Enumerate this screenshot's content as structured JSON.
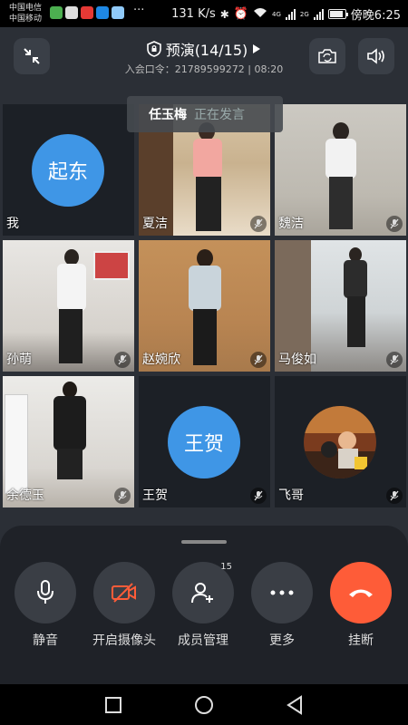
{
  "status_bar": {
    "carrier_1": "中国电信",
    "carrier_2": "中国移动",
    "more": "···",
    "speed": "131 K/s",
    "net_1": "4G",
    "net_2": "2G",
    "time": "傍晚6:25"
  },
  "meeting": {
    "title": "预演(14/15)",
    "code_label": "入会口令：",
    "code": "21789599272",
    "separator": "|",
    "duration": "08:20"
  },
  "speaking": {
    "name": "任玉梅",
    "status": "正在发言"
  },
  "participants": [
    {
      "name": "我",
      "avatar_text": "起东",
      "muted": false
    },
    {
      "name": "夏洁",
      "muted": true
    },
    {
      "name": "魏洁",
      "muted": true
    },
    {
      "name": "孙萌",
      "muted": true
    },
    {
      "name": "赵婉欣",
      "muted": true
    },
    {
      "name": "马俊如",
      "muted": true
    },
    {
      "name": "余德玉",
      "muted": true
    },
    {
      "name": "王贺",
      "avatar_text": "王贺",
      "muted": true
    },
    {
      "name": "飞哥",
      "muted": true
    }
  ],
  "controls": {
    "mute": "静音",
    "camera": "开启摄像头",
    "members": "成员管理",
    "members_count": "15",
    "more": "更多",
    "hangup": "挂断"
  },
  "colors": {
    "avatar_blue": "#3f96e6",
    "hangup_red": "#fe5c38",
    "camera_off_red": "#fe5c38"
  }
}
